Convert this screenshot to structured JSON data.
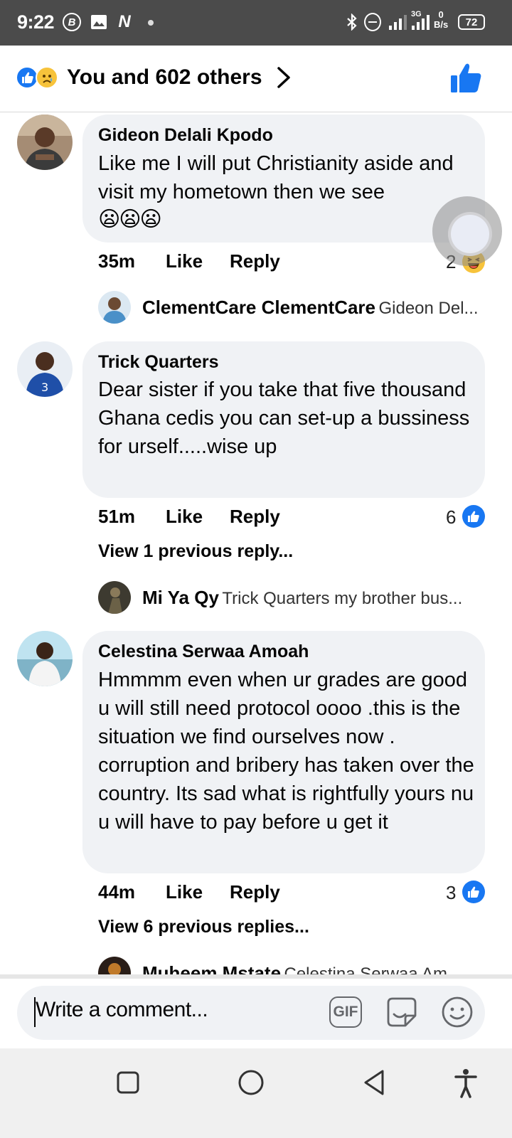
{
  "status_bar": {
    "time": "9:22",
    "b_icon": "B",
    "n_icon": "N",
    "network_type": "3G",
    "speed_value": "0",
    "speed_unit": "B/s",
    "battery": "72"
  },
  "header": {
    "title": "You and 602 others"
  },
  "comments": [
    {
      "author": "Gideon Delali Kpodo",
      "text": "Like me I will put Christianity aside and visit my hometown then we see",
      "emoji": "😦😦😦",
      "time": "35m",
      "like_label": "Like",
      "reply_label": "Reply",
      "reaction_count": "2",
      "reaction_icon": "haha-emoji-icon",
      "view_previous": "",
      "reply_preview": {
        "author": "ClementCare ClementCare",
        "snippet": "Gideon Del..."
      }
    },
    {
      "author": "Trick Quarters",
      "text": "Dear sister if you take that five thousand Ghana cedis you can set-up a bussiness for urself.....wise up",
      "emoji": "",
      "time": "51m",
      "like_label": "Like",
      "reply_label": "Reply",
      "reaction_count": "6",
      "reaction_icon": "like-reaction-icon",
      "view_previous": "View 1 previous reply...",
      "reply_preview": {
        "author": "Mi Ya Qy",
        "snippet": "Trick Quarters my brother bus..."
      }
    },
    {
      "author": "Celestina Serwaa Amoah",
      "text": "Hmmmm even when ur grades are good u will still need protocol oooo .this is the situation we find ourselves now . corruption and bribery has taken over the country. Its sad what is rightfully yours nu u will have to pay before u get it",
      "emoji": "",
      "time": "44m",
      "like_label": "Like",
      "reply_label": "Reply",
      "reaction_count": "3",
      "reaction_icon": "like-reaction-icon",
      "view_previous": "View 6 previous replies...",
      "reply_preview": {
        "author": "Muheem Mstate",
        "snippet": "Celestina Serwaa Am..."
      }
    }
  ],
  "composer": {
    "placeholder": "Write a comment...",
    "gif_label": "GIF"
  },
  "colors": {
    "accent": "#1877f2",
    "bubble": "#f0f2f5",
    "status_bar": "#4b4b4b"
  }
}
